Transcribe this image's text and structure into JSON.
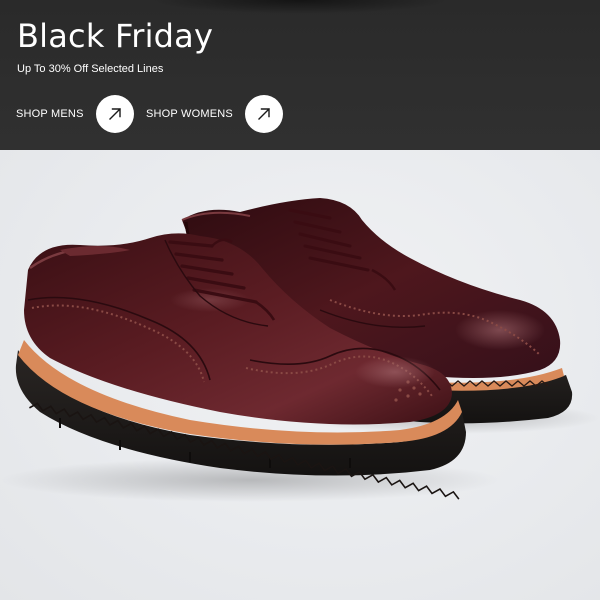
{
  "banner": {
    "title": "Black Friday",
    "subtitle": "Up To 30% Off Selected Lines",
    "ctas": [
      {
        "label": "SHOP MENS",
        "icon": "arrow-up-right-icon"
      },
      {
        "label": "SHOP WOMENS",
        "icon": "arrow-up-right-icon"
      }
    ],
    "background_color": "#2d2d2d",
    "text_color": "#ffffff"
  },
  "product_image": {
    "subject": "pair of burgundy leather brogue derby shoes",
    "leather_color": "#4a1419",
    "welt_accent_color": "#d98a5a",
    "sole_color": "#1f1c1a",
    "background_color": "#e9ebee"
  }
}
